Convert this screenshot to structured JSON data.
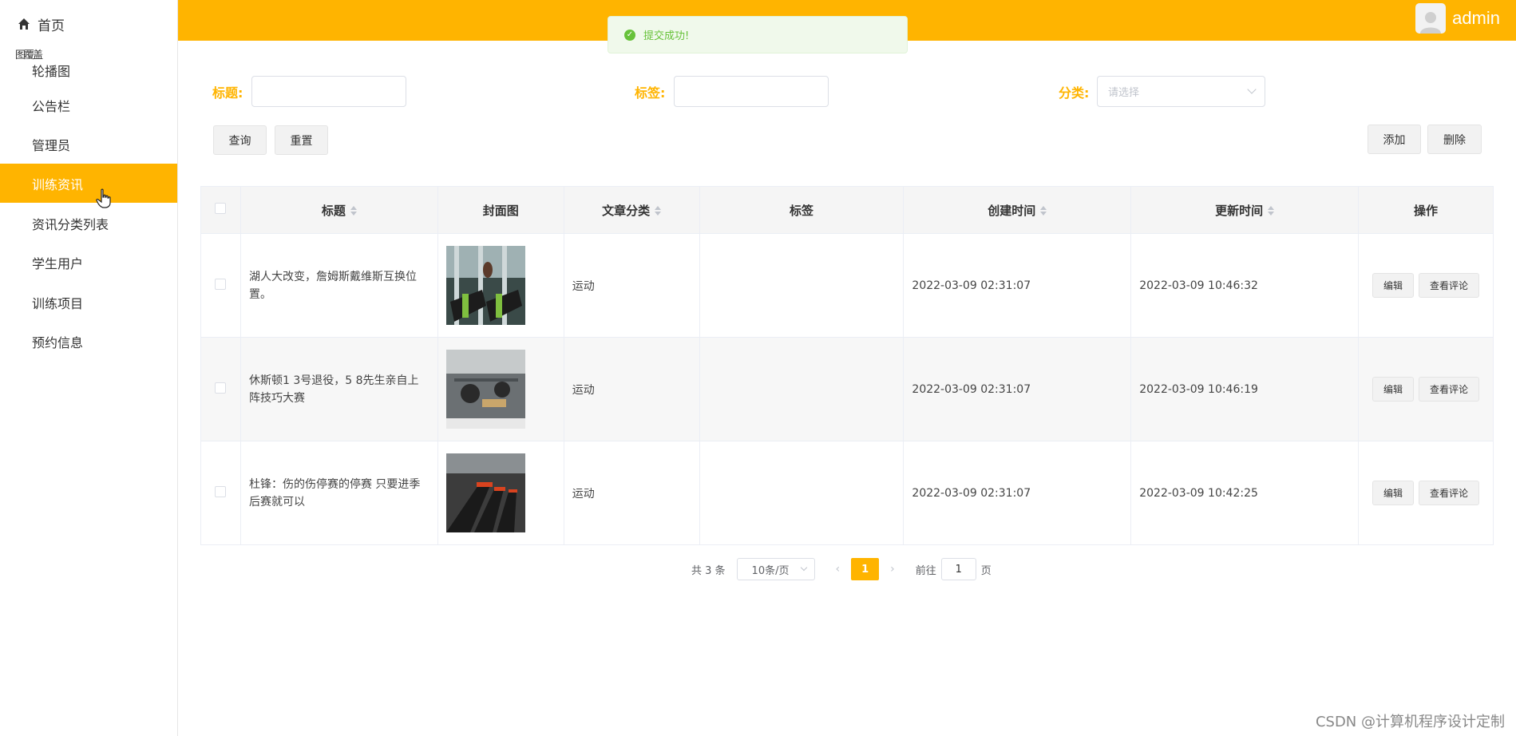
{
  "header": {
    "username": "admin"
  },
  "toast": {
    "message": "提交成功!"
  },
  "sidebar": {
    "home_label": "首页",
    "overlap_text": "图覆盖",
    "items": [
      {
        "label": "轮播图"
      },
      {
        "label": "公告栏"
      },
      {
        "label": "管理员"
      },
      {
        "label": "训练资讯",
        "active": true
      },
      {
        "label": "资讯分类列表"
      },
      {
        "label": "学生用户"
      },
      {
        "label": "训练项目"
      },
      {
        "label": "预约信息"
      }
    ]
  },
  "search": {
    "title_label": "标题:",
    "tag_label": "标签:",
    "category_label": "分类:",
    "category_placeholder": "请选择",
    "query_button": "查询",
    "reset_button": "重置"
  },
  "toolbar": {
    "add_button": "添加",
    "delete_button": "删除"
  },
  "table": {
    "columns": [
      "标题",
      "封面图",
      "文章分类",
      "标签",
      "创建时间",
      "更新时间",
      "操作"
    ],
    "rows": [
      {
        "title": "湖人大改变，詹姆斯戴维斯互换位置。",
        "category": "运动",
        "tags": "",
        "created": "2022-03-09 02:31:07",
        "updated": "2022-03-09 10:46:32"
      },
      {
        "title": "休斯顿1 3号退役，5 8先生亲自上阵技巧大赛",
        "category": "运动",
        "tags": "",
        "created": "2022-03-09 02:31:07",
        "updated": "2022-03-09 10:46:19"
      },
      {
        "title": "杜锋：伤的伤停赛的停赛 只要进季后赛就可以",
        "category": "运动",
        "tags": "",
        "created": "2022-03-09 02:31:07",
        "updated": "2022-03-09 10:42:25"
      }
    ],
    "edit_label": "编辑",
    "comment_label": "查看评论"
  },
  "pagination": {
    "total": "共 3 条",
    "page_size": "10条/页",
    "current_page": "1",
    "goto_prefix": "前往",
    "goto_value": "1",
    "goto_suffix": "页"
  },
  "watermark": "CSDN @计算机程序设计定制",
  "colors": {
    "accent": "#ffb400",
    "success": "#67c23a"
  }
}
